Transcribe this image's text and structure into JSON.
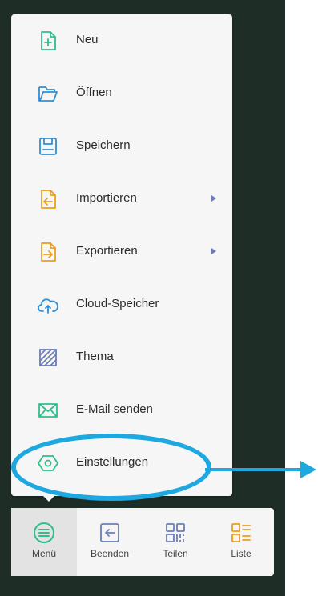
{
  "menu": {
    "items": [
      {
        "label": "Neu",
        "icon": "new-file-icon",
        "color": "#2fbf8a",
        "submenu": false
      },
      {
        "label": "Öffnen",
        "icon": "folder-open-icon",
        "color": "#2f8fd6",
        "submenu": false
      },
      {
        "label": "Speichern",
        "icon": "save-icon",
        "color": "#2f8fd6",
        "submenu": false
      },
      {
        "label": "Importieren",
        "icon": "import-icon",
        "color": "#e8a020",
        "submenu": true
      },
      {
        "label": "Exportieren",
        "icon": "export-icon",
        "color": "#e8a020",
        "submenu": true
      },
      {
        "label": "Cloud-Speicher",
        "icon": "cloud-upload-icon",
        "color": "#2f8fd6",
        "submenu": false
      },
      {
        "label": "Thema",
        "icon": "theme-icon",
        "color": "#6a7db9",
        "submenu": false
      },
      {
        "label": "E-Mail senden",
        "icon": "mail-icon",
        "color": "#2fbf8a",
        "submenu": false
      },
      {
        "label": "Einstellungen",
        "icon": "settings-hexagon-icon",
        "color": "#2fbf8a",
        "submenu": false
      }
    ]
  },
  "toolbar": {
    "buttons": [
      {
        "label": "Menü",
        "icon": "menu-lines-icon",
        "color": "#2fbf8a",
        "active": true
      },
      {
        "label": "Beenden",
        "icon": "exit-icon",
        "color": "#6a7db9",
        "active": false
      },
      {
        "label": "Teilen",
        "icon": "qr-code-icon",
        "color": "#6a7db9",
        "active": false
      },
      {
        "label": "Liste",
        "icon": "list-icon",
        "color": "#e8a020",
        "active": false
      }
    ]
  },
  "annotation": {
    "color": "#1ea8e0"
  }
}
